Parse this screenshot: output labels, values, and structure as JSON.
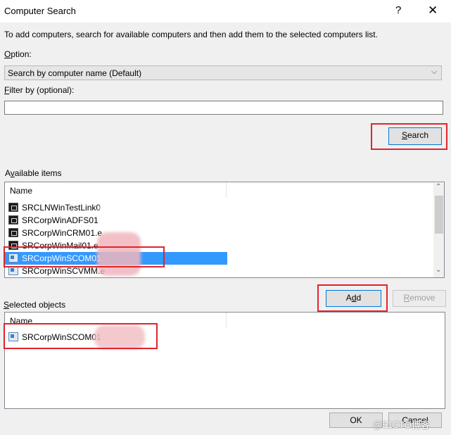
{
  "dialog": {
    "title": "Computer Search",
    "help_label": "?",
    "close_label": "✕",
    "instructions": "To add computers, search for available computers and then add them to the selected computers list."
  },
  "option": {
    "label_key": "O",
    "label_rest": "ption:",
    "selected": "Search by computer name (Default)",
    "arrow": "⌵"
  },
  "filter": {
    "label_key": "F",
    "label_rest": "ilter by (optional):",
    "value": ""
  },
  "search_button": {
    "label_key": "S",
    "label_rest": "earch"
  },
  "available": {
    "label_pre": "A",
    "label_key": "v",
    "label_rest": "ailable items",
    "column_header": "Name",
    "items": [
      {
        "name": "SRCLNWinTestLink0",
        "icon": "server-dark-icon",
        "selected": false
      },
      {
        "name": "SRCorpWinADFS01",
        "icon": "server-dark-icon",
        "selected": false
      },
      {
        "name": "SRCorpWinCRM01.e",
        "icon": "server-dark-icon",
        "selected": false
      },
      {
        "name": "SRCorpWinMail01.e",
        "icon": "server-dark-icon",
        "selected": false
      },
      {
        "name": "SRCorpWinSCOM01.",
        "icon": "server-managed-icon",
        "selected": true
      },
      {
        "name": "SRCorpWinSCVMM.e",
        "icon": "server-managed-icon",
        "selected": false
      }
    ],
    "scroll_up": "⌃",
    "scroll_down": "⌄"
  },
  "add_button": {
    "label_pre": "A",
    "label_key": "d",
    "label_rest": "d"
  },
  "remove_button": {
    "label_key": "R",
    "label_rest": "emove"
  },
  "selected_objects": {
    "label_key": "S",
    "label_rest": "elected objects",
    "column_header": "Name",
    "items": [
      {
        "name": "SRCorpWinSCOM01",
        "icon": "server-managed-icon"
      }
    ]
  },
  "ok_button": {
    "label": "OK"
  },
  "cancel_button": {
    "label": "Cancel"
  },
  "watermark": "@51CTO博客",
  "colors": {
    "highlight_red": "#e0242b",
    "selection_blue": "#3399ff",
    "default_button_border": "#0078d7"
  }
}
